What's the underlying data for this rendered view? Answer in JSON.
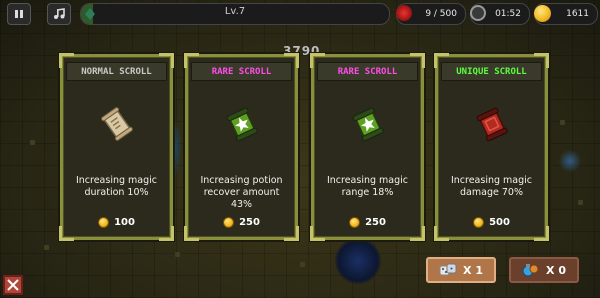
{
  "hud": {
    "level": "Lv.7",
    "xp_progress": 0.04,
    "kills": "9 / 500",
    "timer": "01:52",
    "gold": "1611"
  },
  "floating_score": "3790",
  "cards": [
    {
      "title": "NORMAL SCROLL",
      "title_color": "#c9c9c9",
      "icon": "paper-scroll-icon",
      "description": "Increasing magic duration 10%",
      "price": "100"
    },
    {
      "title": "RARE SCROLL",
      "title_color": "#ff4de8",
      "icon": "green-scroll-icon",
      "description": "Increasing potion recover amount 43%",
      "price": "250"
    },
    {
      "title": "RARE SCROLL",
      "title_color": "#ff4de8",
      "icon": "green-scroll-icon",
      "description": "Increasing magic range 18%",
      "price": "250"
    },
    {
      "title": "UNIQUE SCROLL",
      "title_color": "#5cff3c",
      "icon": "red-scroll-icon",
      "description": "Increasing magic damage 70%",
      "price": "500"
    }
  ],
  "items": [
    {
      "name": "reroll",
      "label": "X 1",
      "icon": "dice-icon",
      "bg": "#b0764a"
    },
    {
      "name": "potion",
      "label": "X 0",
      "icon": "potion-icon",
      "bg": "#6a3f2c"
    }
  ]
}
